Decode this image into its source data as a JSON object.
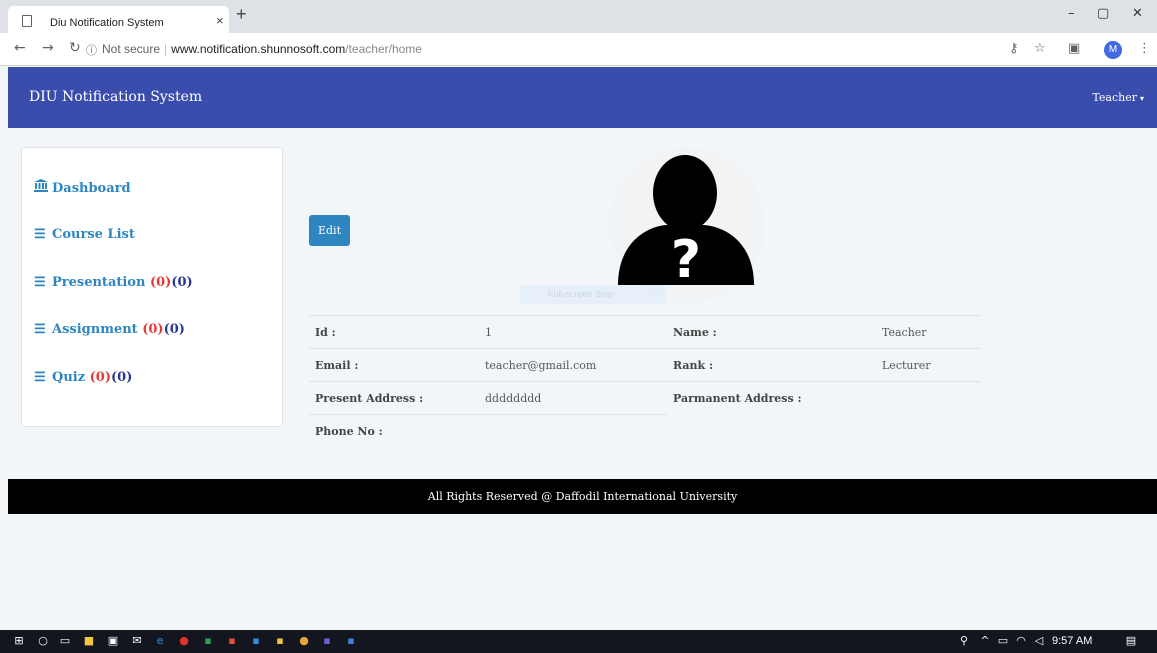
{
  "browser": {
    "tab_title": "Diu Notification System",
    "tab_close": "×",
    "new_tab": "+",
    "secure_label": "Not secure",
    "url_host": "www.notification.shunnosoft.com",
    "url_path": "/teacher/home",
    "profile_initial": "M",
    "window_controls": {
      "minimize": "–",
      "restore": "▢",
      "close": "✕"
    },
    "icons": [
      "back-arrow-icon",
      "forward-arrow-icon",
      "reload-icon",
      "info-icon",
      "key-icon",
      "star-icon",
      "extension-icon",
      "menu-dots-icon"
    ]
  },
  "navbar": {
    "brand": "DIU Notification System",
    "user_menu": "Teacher",
    "caret": "▾",
    "bg_color": "#3a4cac"
  },
  "sidebar": {
    "items": [
      {
        "label": "Dashboard",
        "icon": "bank-icon"
      },
      {
        "label": "Course List",
        "icon": "list-icon"
      },
      {
        "label": "Presentation",
        "icon": "list-icon",
        "count_new": "(0)",
        "count_total": "(0)"
      },
      {
        "label": "Assignment",
        "icon": "list-icon",
        "count_new": "(0)",
        "count_total": "(0)"
      },
      {
        "label": "Quiz",
        "icon": "list-icon",
        "count_new": "(0)",
        "count_total": "(0)"
      }
    ],
    "accent": "#2e86c1"
  },
  "profile": {
    "edit_label": "Edit",
    "image_icon": "unknown-user-icon",
    "snip_overlay": "Full-screen Snip",
    "fields": [
      [
        {
          "label": "Id :",
          "value": "1"
        },
        {
          "label": "Name :",
          "value": "Teacher"
        }
      ],
      [
        {
          "label": "Email :",
          "value": "teacher@gmail.com"
        },
        {
          "label": "Rank :",
          "value": "Lecturer"
        }
      ],
      [
        {
          "label": "Present Address :",
          "value": "dddddddd"
        },
        {
          "label": "Parmanent Address :",
          "value": ""
        }
      ],
      [
        {
          "label": "Phone No :",
          "value": ""
        },
        {
          "label": "",
          "value": ""
        }
      ]
    ]
  },
  "footer": {
    "text": "All Rights Reserved @ Daffodil International University"
  },
  "taskbar": {
    "time": "9:57 AM"
  }
}
